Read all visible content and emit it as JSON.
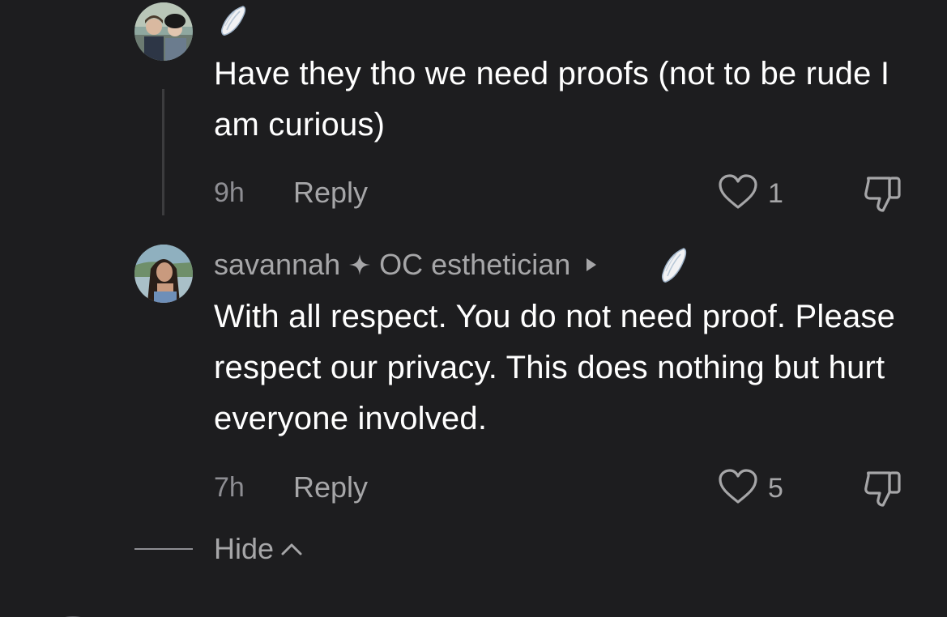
{
  "comments": [
    {
      "text": "Have they tho we need proofs (not to be rude I am curious)",
      "time": "9h",
      "reply_label": "Reply",
      "likes": "1",
      "avatar_icon": "avatar-two-people",
      "badge_icon": "angel-wing-icon"
    },
    {
      "username": "savannah",
      "separator_icon": "sparkle-icon",
      "bio": "OC esthetician",
      "badge_icon": "angel-wing-icon",
      "text": "With all respect. You do not need proof. Please respect our privacy. This does nothing but hurt everyone involved.",
      "time": "7h",
      "reply_label": "Reply",
      "likes": "5",
      "avatar_icon": "avatar-woman"
    }
  ],
  "hide_label": "Hide",
  "colors": {
    "background": "#1d1d1f",
    "primary_text": "#ffffff",
    "secondary_text": "#a6a6a8",
    "thread_line": "#3c3c3e"
  }
}
